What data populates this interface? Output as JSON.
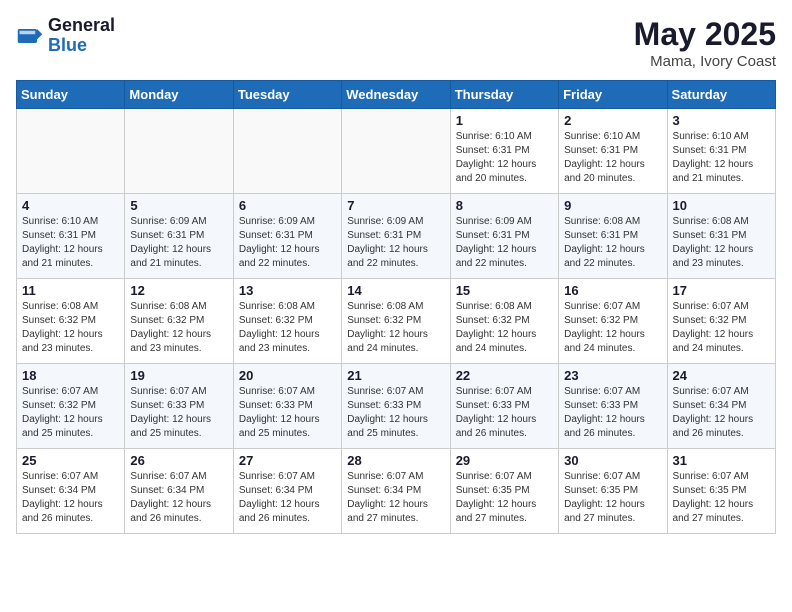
{
  "header": {
    "logo_general": "General",
    "logo_blue": "Blue",
    "month_year": "May 2025",
    "location": "Mama, Ivory Coast"
  },
  "weekdays": [
    "Sunday",
    "Monday",
    "Tuesday",
    "Wednesday",
    "Thursday",
    "Friday",
    "Saturday"
  ],
  "weeks": [
    [
      {
        "day": "",
        "empty": true
      },
      {
        "day": "",
        "empty": true
      },
      {
        "day": "",
        "empty": true
      },
      {
        "day": "",
        "empty": true
      },
      {
        "day": "1",
        "sunrise": "6:10 AM",
        "sunset": "6:31 PM",
        "daylight": "12 hours and 20 minutes."
      },
      {
        "day": "2",
        "sunrise": "6:10 AM",
        "sunset": "6:31 PM",
        "daylight": "12 hours and 20 minutes."
      },
      {
        "day": "3",
        "sunrise": "6:10 AM",
        "sunset": "6:31 PM",
        "daylight": "12 hours and 21 minutes."
      }
    ],
    [
      {
        "day": "4",
        "sunrise": "6:10 AM",
        "sunset": "6:31 PM",
        "daylight": "12 hours and 21 minutes."
      },
      {
        "day": "5",
        "sunrise": "6:09 AM",
        "sunset": "6:31 PM",
        "daylight": "12 hours and 21 minutes."
      },
      {
        "day": "6",
        "sunrise": "6:09 AM",
        "sunset": "6:31 PM",
        "daylight": "12 hours and 22 minutes."
      },
      {
        "day": "7",
        "sunrise": "6:09 AM",
        "sunset": "6:31 PM",
        "daylight": "12 hours and 22 minutes."
      },
      {
        "day": "8",
        "sunrise": "6:09 AM",
        "sunset": "6:31 PM",
        "daylight": "12 hours and 22 minutes."
      },
      {
        "day": "9",
        "sunrise": "6:08 AM",
        "sunset": "6:31 PM",
        "daylight": "12 hours and 22 minutes."
      },
      {
        "day": "10",
        "sunrise": "6:08 AM",
        "sunset": "6:31 PM",
        "daylight": "12 hours and 23 minutes."
      }
    ],
    [
      {
        "day": "11",
        "sunrise": "6:08 AM",
        "sunset": "6:32 PM",
        "daylight": "12 hours and 23 minutes."
      },
      {
        "day": "12",
        "sunrise": "6:08 AM",
        "sunset": "6:32 PM",
        "daylight": "12 hours and 23 minutes."
      },
      {
        "day": "13",
        "sunrise": "6:08 AM",
        "sunset": "6:32 PM",
        "daylight": "12 hours and 23 minutes."
      },
      {
        "day": "14",
        "sunrise": "6:08 AM",
        "sunset": "6:32 PM",
        "daylight": "12 hours and 24 minutes."
      },
      {
        "day": "15",
        "sunrise": "6:08 AM",
        "sunset": "6:32 PM",
        "daylight": "12 hours and 24 minutes."
      },
      {
        "day": "16",
        "sunrise": "6:07 AM",
        "sunset": "6:32 PM",
        "daylight": "12 hours and 24 minutes."
      },
      {
        "day": "17",
        "sunrise": "6:07 AM",
        "sunset": "6:32 PM",
        "daylight": "12 hours and 24 minutes."
      }
    ],
    [
      {
        "day": "18",
        "sunrise": "6:07 AM",
        "sunset": "6:32 PM",
        "daylight": "12 hours and 25 minutes."
      },
      {
        "day": "19",
        "sunrise": "6:07 AM",
        "sunset": "6:33 PM",
        "daylight": "12 hours and 25 minutes."
      },
      {
        "day": "20",
        "sunrise": "6:07 AM",
        "sunset": "6:33 PM",
        "daylight": "12 hours and 25 minutes."
      },
      {
        "day": "21",
        "sunrise": "6:07 AM",
        "sunset": "6:33 PM",
        "daylight": "12 hours and 25 minutes."
      },
      {
        "day": "22",
        "sunrise": "6:07 AM",
        "sunset": "6:33 PM",
        "daylight": "12 hours and 26 minutes."
      },
      {
        "day": "23",
        "sunrise": "6:07 AM",
        "sunset": "6:33 PM",
        "daylight": "12 hours and 26 minutes."
      },
      {
        "day": "24",
        "sunrise": "6:07 AM",
        "sunset": "6:34 PM",
        "daylight": "12 hours and 26 minutes."
      }
    ],
    [
      {
        "day": "25",
        "sunrise": "6:07 AM",
        "sunset": "6:34 PM",
        "daylight": "12 hours and 26 minutes."
      },
      {
        "day": "26",
        "sunrise": "6:07 AM",
        "sunset": "6:34 PM",
        "daylight": "12 hours and 26 minutes."
      },
      {
        "day": "27",
        "sunrise": "6:07 AM",
        "sunset": "6:34 PM",
        "daylight": "12 hours and 26 minutes."
      },
      {
        "day": "28",
        "sunrise": "6:07 AM",
        "sunset": "6:34 PM",
        "daylight": "12 hours and 27 minutes."
      },
      {
        "day": "29",
        "sunrise": "6:07 AM",
        "sunset": "6:35 PM",
        "daylight": "12 hours and 27 minutes."
      },
      {
        "day": "30",
        "sunrise": "6:07 AM",
        "sunset": "6:35 PM",
        "daylight": "12 hours and 27 minutes."
      },
      {
        "day": "31",
        "sunrise": "6:07 AM",
        "sunset": "6:35 PM",
        "daylight": "12 hours and 27 minutes."
      }
    ]
  ],
  "labels": {
    "sunrise_prefix": "Sunrise: ",
    "sunset_prefix": "Sunset: ",
    "daylight_prefix": "Daylight: "
  }
}
